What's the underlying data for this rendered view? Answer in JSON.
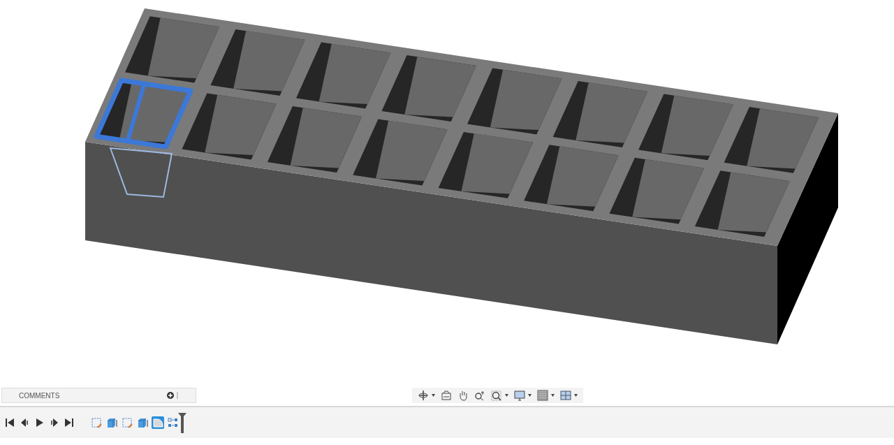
{
  "comments": {
    "title": "COMMENTS"
  },
  "timeline": {
    "features": [
      {
        "kind": "sketch",
        "selected": false
      },
      {
        "kind": "extrude",
        "selected": false
      },
      {
        "kind": "sketch",
        "selected": false
      },
      {
        "kind": "extrude",
        "selected": false
      },
      {
        "kind": "fillet",
        "selected": true
      },
      {
        "kind": "pattern",
        "selected": false
      }
    ]
  }
}
